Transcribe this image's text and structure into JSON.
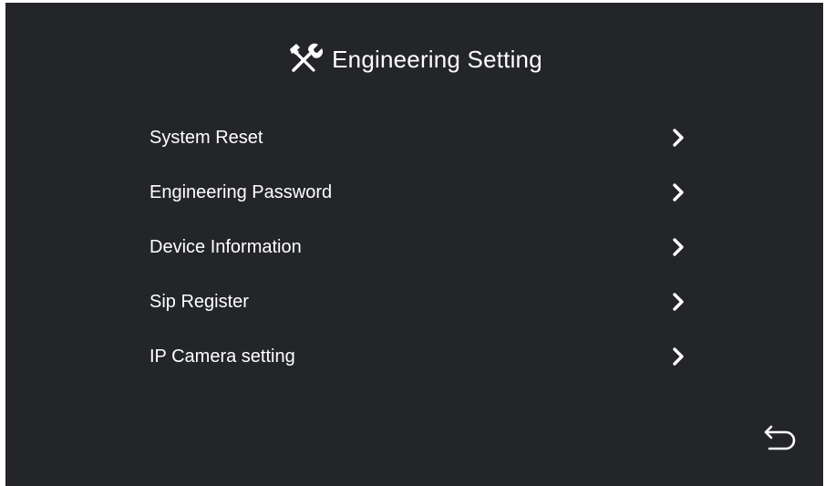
{
  "header": {
    "icon": "tools-icon",
    "title": "Engineering Setting"
  },
  "menu": {
    "items": [
      {
        "label": "System Reset",
        "icon": "chevron-right-icon"
      },
      {
        "label": "Engineering Password",
        "icon": "chevron-right-icon"
      },
      {
        "label": "Device Information",
        "icon": "chevron-right-icon"
      },
      {
        "label": "Sip Register",
        "icon": "chevron-right-icon"
      },
      {
        "label": "IP Camera setting",
        "icon": "chevron-right-icon"
      }
    ]
  },
  "footer": {
    "back_icon": "back-arrow-icon"
  },
  "colors": {
    "background": "#232529",
    "text": "#ffffff"
  }
}
